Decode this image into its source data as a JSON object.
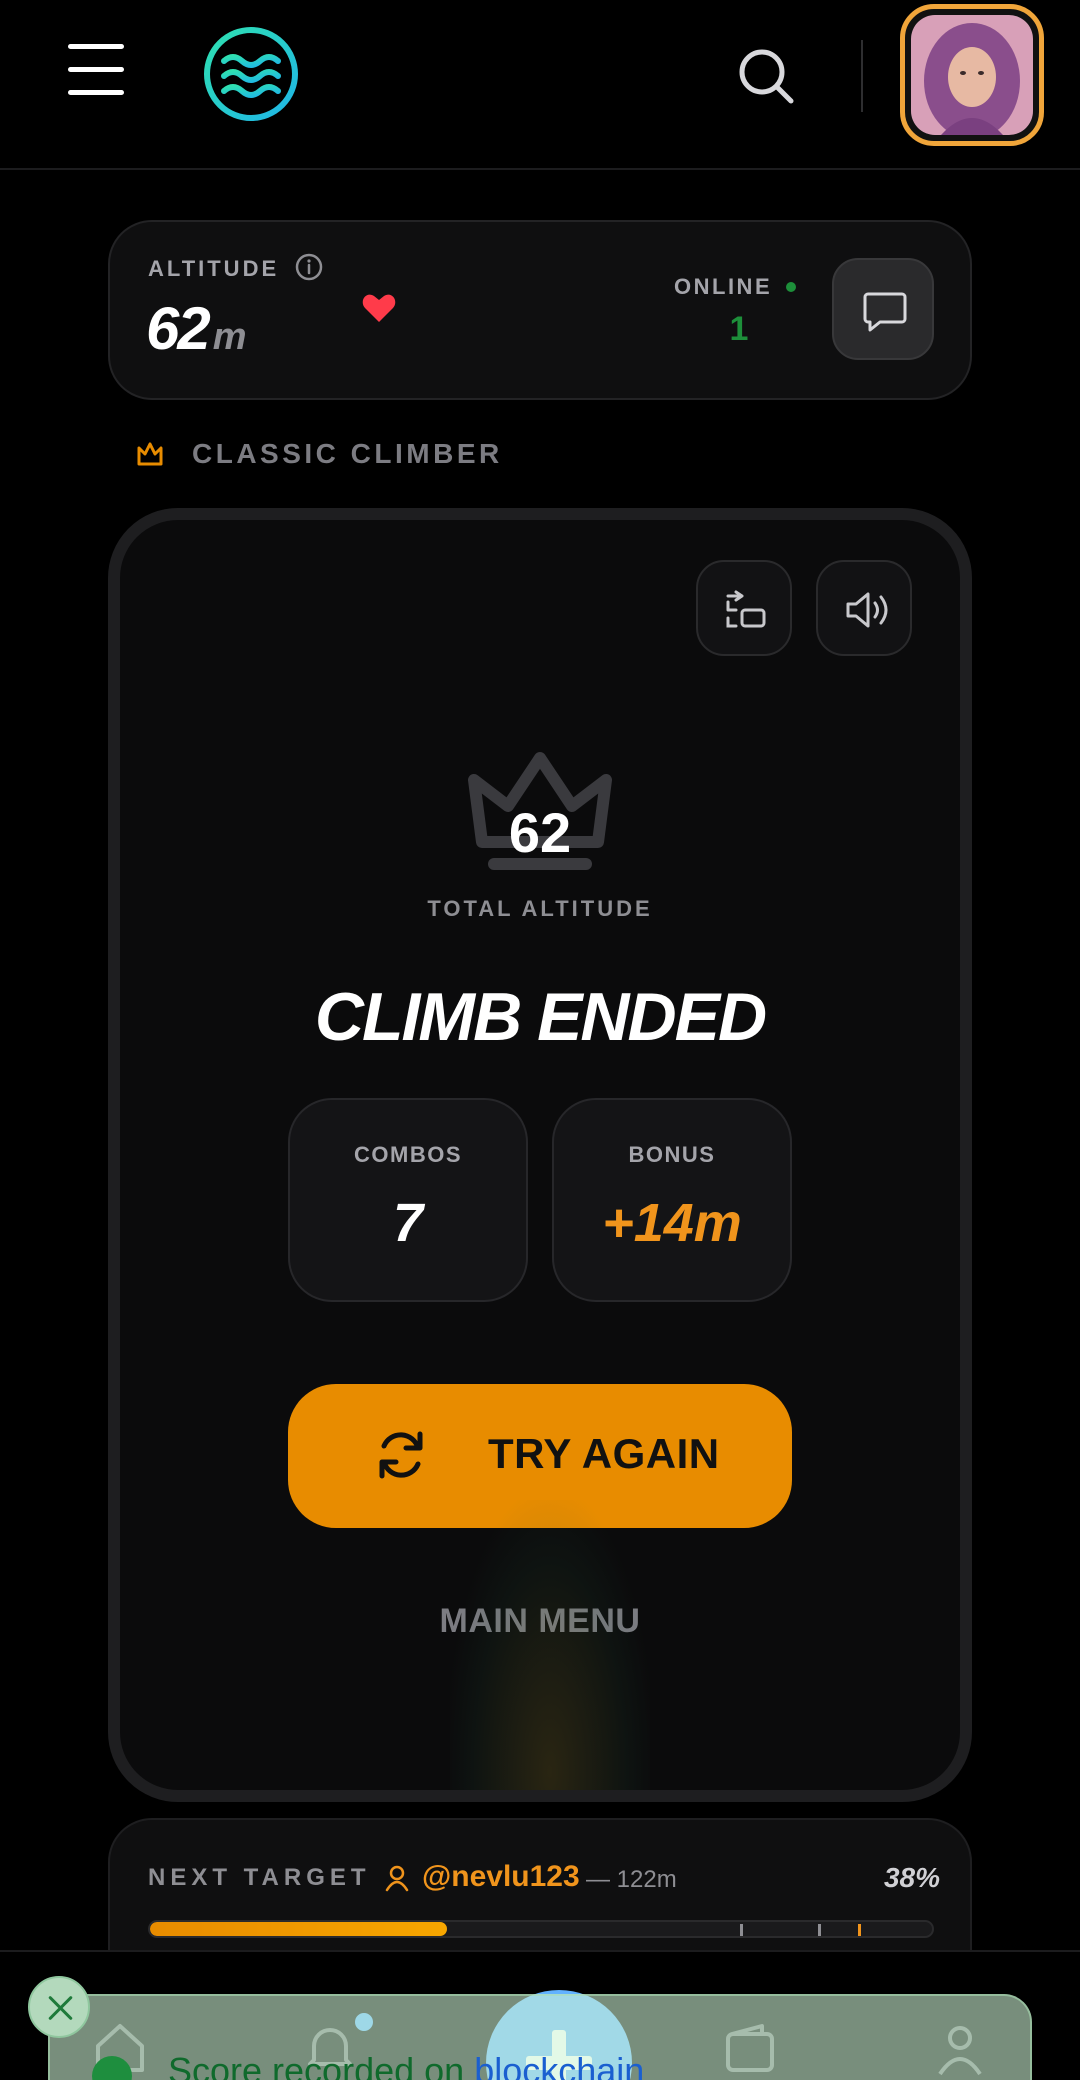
{
  "header": {
    "menu_icon": "hamburger-menu-icon",
    "logo_icon": "waves-logo-icon",
    "search_icon": "search-icon",
    "avatar": "user-avatar"
  },
  "status": {
    "altitude_label": "ALTITUDE",
    "altitude_value": "62",
    "altitude_unit": "m",
    "online_label": "ONLINE",
    "online_count": "1"
  },
  "mode": {
    "label": "CLASSIC CLIMBER"
  },
  "game": {
    "total_score": "62",
    "total_label": "TOTAL ALTITUDE",
    "result_title": "CLIMB ENDED",
    "combos_label": "COMBOS",
    "combos_value": "7",
    "bonus_label": "BONUS",
    "bonus_value": "+14m",
    "try_again_label": "TRY AGAIN",
    "main_menu_label": "MAIN MENU"
  },
  "target": {
    "label": "NEXT TARGET",
    "username": "@nevlu123",
    "distance": "— 122m",
    "percent": "38%",
    "progress": 0.38
  },
  "toast": {
    "text_before": "Score recorded on ",
    "text_link": "blockchain"
  },
  "colors": {
    "accent": "#e88c00",
    "online": "#1d8f3a",
    "heart": "#ff3b4a",
    "fab": "#62b2ff"
  }
}
